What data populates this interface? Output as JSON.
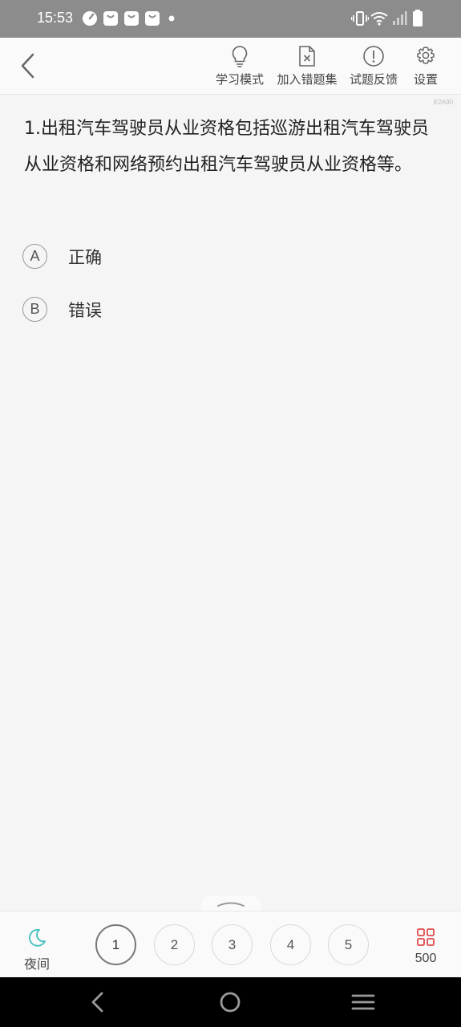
{
  "status_bar": {
    "time": "15:53"
  },
  "toolbar": {
    "study_mode_label": "学习模式",
    "add_mistakes_label": "加入错题集",
    "feedback_label": "试题反馈",
    "settings_label": "设置"
  },
  "question": {
    "code": "E2A90",
    "text": "1.出租汽车驾驶员从业资格包括巡游出租汽车驾驶员从业资格和网络预约出租汽车驾驶员从业资格等。",
    "options": [
      {
        "letter": "A",
        "text": "正确"
      },
      {
        "letter": "B",
        "text": "错误"
      }
    ]
  },
  "bottom_bar": {
    "night_label": "夜间",
    "question_numbers": [
      "1",
      "2",
      "3",
      "4",
      "5"
    ],
    "current_question": "1",
    "total_count": "500"
  },
  "colors": {
    "accent_night": "#3fbfbf",
    "grid_icon": "#e24b4b",
    "status_bar_bg": "#8c8c8c"
  }
}
